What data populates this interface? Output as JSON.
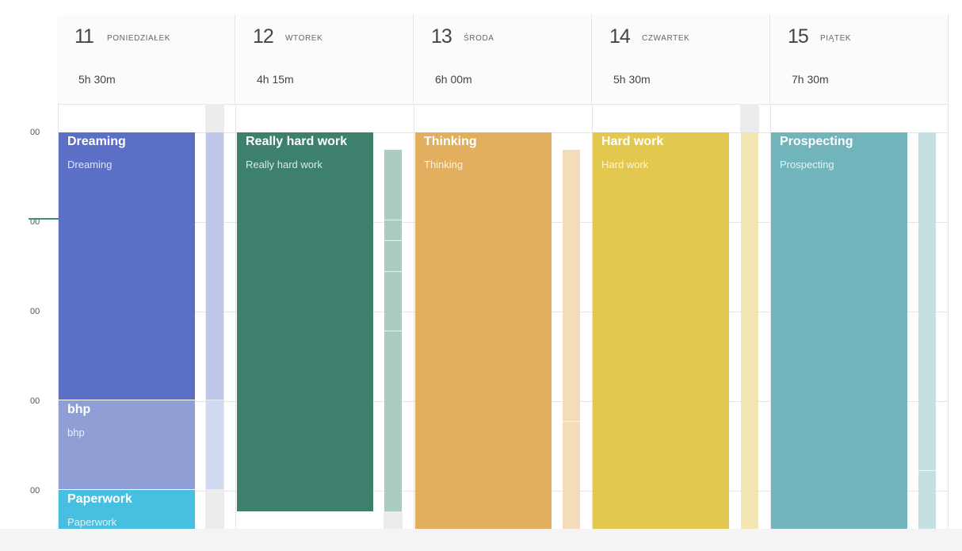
{
  "days": [
    {
      "num": "11",
      "name": "PONIEDZIAŁEK",
      "total": "5h 30m"
    },
    {
      "num": "12",
      "name": "WTOREK",
      "total": "4h 15m"
    },
    {
      "num": "13",
      "name": "ŚRODA",
      "total": "6h 00m"
    },
    {
      "num": "14",
      "name": "CZWARTEK",
      "total": "5h 30m"
    },
    {
      "num": "15",
      "name": "PIĄTEK",
      "total": "7h 30m"
    }
  ],
  "time_labels": [
    "00",
    "00",
    "00",
    "00",
    "00"
  ],
  "entries": [
    {
      "title": "Dreaming",
      "subtitle": "Dreaming",
      "color": "#5c6fc6"
    },
    {
      "title": "bhp",
      "subtitle": "bhp",
      "color": "#8f9fd6"
    },
    {
      "title": "Paperwork",
      "subtitle": "Paperwork",
      "color": "#46bfe0"
    },
    {
      "title": "Really hard work",
      "subtitle": "Really hard work",
      "color": "#3d806d"
    },
    {
      "title": "Thinking",
      "subtitle": "Thinking",
      "color": "#e2af5e"
    },
    {
      "title": "Hard work",
      "subtitle": "Hard work",
      "color": "#e2c84e"
    },
    {
      "title": "Prospecting",
      "subtitle": "Prospecting",
      "color": "#72b4bc"
    }
  ],
  "colors": {
    "now_indicator": "#3f8f78",
    "grid_line": "#e4e4e4",
    "background": "#ffffff"
  }
}
